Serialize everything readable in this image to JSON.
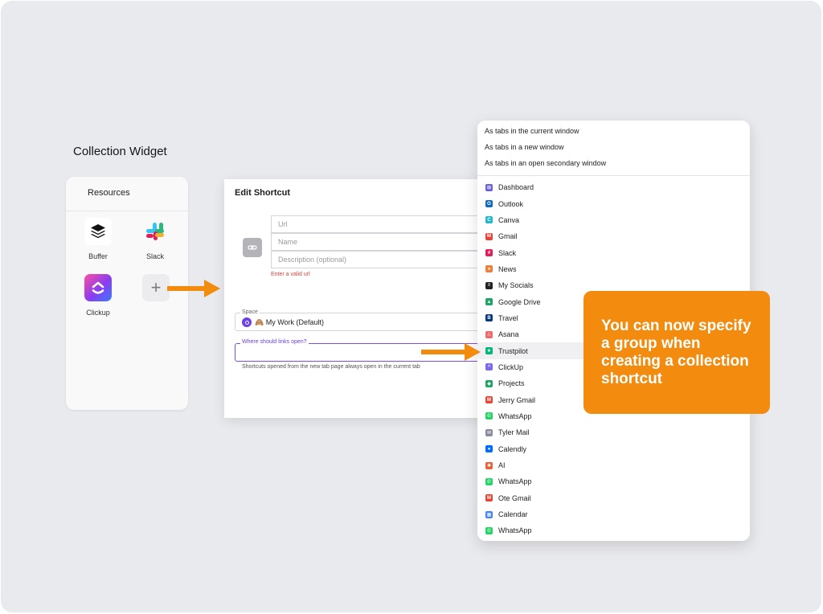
{
  "section_title": "Collection Widget",
  "widget": {
    "header": "Resources",
    "apps": [
      {
        "label": "Buffer",
        "icon": "buffer-icon"
      },
      {
        "label": "Slack",
        "icon": "slack-icon"
      },
      {
        "label": "Clickup",
        "icon": "clickup-icon"
      }
    ],
    "add_symbol": "+"
  },
  "dialog": {
    "title": "Edit Shortcut",
    "url_placeholder": "Url",
    "name_placeholder": "Name",
    "description_placeholder": "Description (optional)",
    "error": "Enter a valid url",
    "space_label": "Space",
    "space_value": "🙈 My Work (Default)",
    "where_label": "Where should links open?",
    "hint": "Shortcuts opened from the new tab page always open in the current tab"
  },
  "dropdown": {
    "open_options": [
      "As tabs in the current window",
      "As tabs in a new window",
      "As tabs in an open secondary window"
    ],
    "groups": [
      {
        "label": "Dashboard",
        "icon": "grid-icon",
        "color": "#6b5fd8"
      },
      {
        "label": "Outlook",
        "icon": "outlook-icon",
        "color": "#0f6cbd"
      },
      {
        "label": "Canva",
        "icon": "canva-icon",
        "color": "#22b9c9"
      },
      {
        "label": "Gmail",
        "icon": "gmail-icon",
        "color": "#ea4335"
      },
      {
        "label": "Slack",
        "icon": "slack-icon",
        "color": "#e01e5a"
      },
      {
        "label": "News",
        "icon": "news-icon",
        "color": "#f07f3a"
      },
      {
        "label": "My Socials",
        "icon": "layers-icon",
        "color": "#222222"
      },
      {
        "label": "Google Drive",
        "icon": "google-drive-icon",
        "color": "#1fa463"
      },
      {
        "label": "Travel",
        "icon": "booking-icon",
        "color": "#003580"
      },
      {
        "label": "Asana",
        "icon": "asana-icon",
        "color": "#f06a6a"
      },
      {
        "label": "Trustpilot",
        "icon": "star-icon",
        "color": "#00b67a"
      },
      {
        "label": "ClickUp",
        "icon": "clickup-icon",
        "color": "#7b68ee"
      },
      {
        "label": "Projects",
        "icon": "projects-icon",
        "color": "#1fa463"
      },
      {
        "label": "Jerry Gmail",
        "icon": "gmail-icon",
        "color": "#ea4335"
      },
      {
        "label": "WhatsApp",
        "icon": "whatsapp-icon",
        "color": "#25d366"
      },
      {
        "label": "Tyler Mail",
        "icon": "mail-icon",
        "color": "#8a8aa0"
      },
      {
        "label": "Calendly",
        "icon": "calendly-icon",
        "color": "#006bff"
      },
      {
        "label": "AI",
        "icon": "ai-icon",
        "color": "#e8633a"
      },
      {
        "label": "WhatsApp",
        "icon": "whatsapp-icon",
        "color": "#25d366"
      },
      {
        "label": "Ote Gmail",
        "icon": "gmail-icon",
        "color": "#ea4335"
      },
      {
        "label": "Calendar",
        "icon": "calendar-icon",
        "color": "#4285f4"
      },
      {
        "label": "WhatsApp",
        "icon": "whatsapp-icon",
        "color": "#25d366"
      }
    ],
    "highlighted": "Trustpilot"
  },
  "callout": "You can now specify a group when creating a collection shortcut",
  "accent_color": "#f28b0e"
}
